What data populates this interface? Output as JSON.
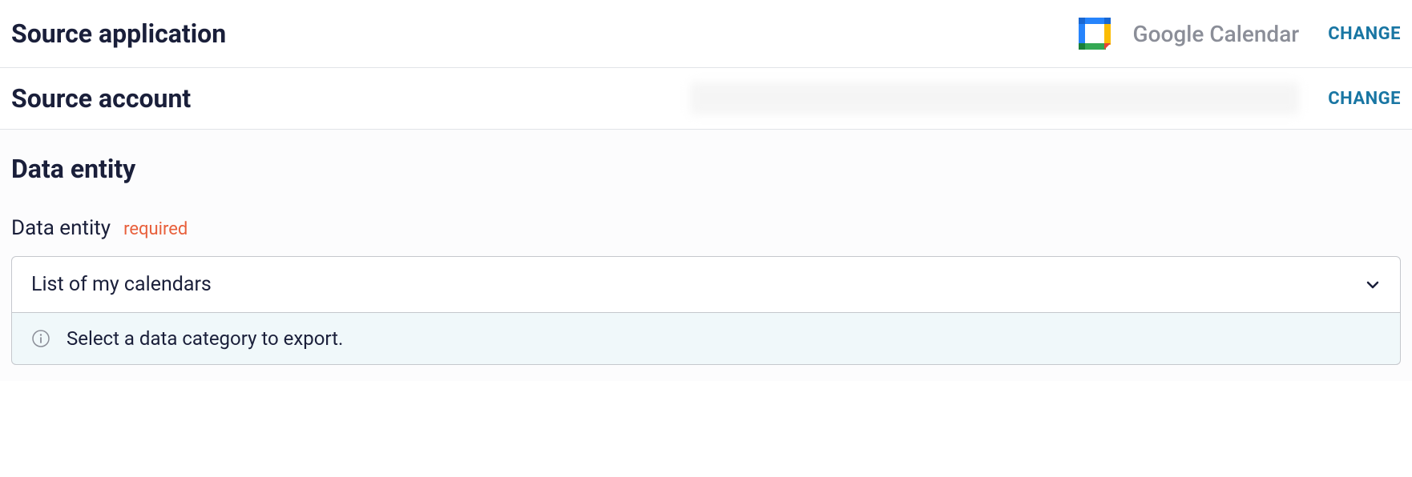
{
  "sourceApplication": {
    "title": "Source application",
    "appName": "Google Calendar",
    "changeLabel": "CHANGE"
  },
  "sourceAccount": {
    "title": "Source account",
    "changeLabel": "CHANGE"
  },
  "dataEntity": {
    "title": "Data entity",
    "fieldLabel": "Data entity",
    "requiredLabel": "required",
    "selectedValue": "List of my calendars",
    "helpText": "Select a data category to export."
  }
}
